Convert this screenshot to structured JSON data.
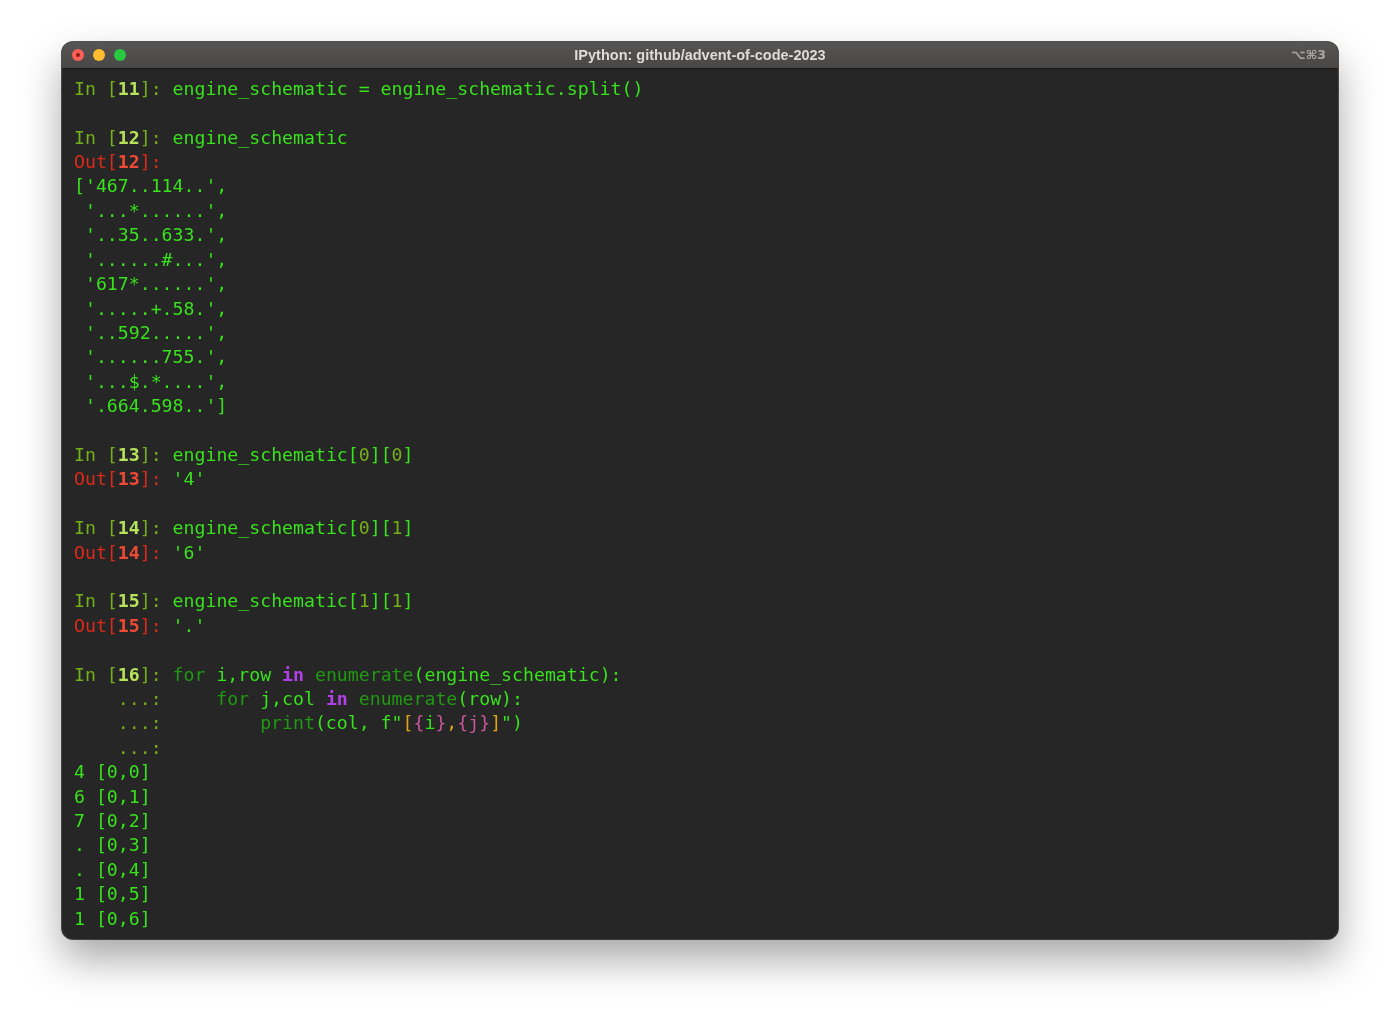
{
  "window": {
    "title": "IPython: github/advent-of-code-2023",
    "shortcut": "⌥⌘3"
  },
  "cells": [
    {
      "lines": [
        [
          {
            "kind": "p",
            "text": "In ["
          },
          {
            "kind": "pn",
            "text": "11"
          },
          {
            "kind": "p",
            "text": "]: "
          },
          {
            "kind": "c",
            "text": "engine_schematic = engine_schematic.split()"
          }
        ]
      ]
    },
    {
      "lines": [
        [
          {
            "kind": "p",
            "text": "In ["
          },
          {
            "kind": "pn",
            "text": "12"
          },
          {
            "kind": "p",
            "text": "]: "
          },
          {
            "kind": "c",
            "text": "engine_schematic"
          }
        ],
        [
          {
            "kind": "o",
            "text": "Out["
          },
          {
            "kind": "on",
            "text": "12"
          },
          {
            "kind": "o",
            "text": "]:"
          }
        ],
        [
          {
            "kind": "c",
            "text": "['467..114..',"
          }
        ],
        [
          {
            "kind": "c",
            "text": " '...*......',"
          }
        ],
        [
          {
            "kind": "c",
            "text": " '..35..633.',"
          }
        ],
        [
          {
            "kind": "c",
            "text": " '......#...',"
          }
        ],
        [
          {
            "kind": "c",
            "text": " '617*......',"
          }
        ],
        [
          {
            "kind": "c",
            "text": " '.....+.58.',"
          }
        ],
        [
          {
            "kind": "c",
            "text": " '..592.....',"
          }
        ],
        [
          {
            "kind": "c",
            "text": " '......755.',"
          }
        ],
        [
          {
            "kind": "c",
            "text": " '...$.*....',"
          }
        ],
        [
          {
            "kind": "c",
            "text": " '.664.598..']"
          }
        ]
      ]
    },
    {
      "lines": [
        [
          {
            "kind": "p",
            "text": "In ["
          },
          {
            "kind": "pn",
            "text": "13"
          },
          {
            "kind": "p",
            "text": "]: "
          },
          {
            "kind": "c",
            "text": "engine_schematic["
          },
          {
            "kind": "n",
            "text": "0"
          },
          {
            "kind": "c",
            "text": "]["
          },
          {
            "kind": "n",
            "text": "0"
          },
          {
            "kind": "c",
            "text": "]"
          }
        ],
        [
          {
            "kind": "o",
            "text": "Out["
          },
          {
            "kind": "on",
            "text": "13"
          },
          {
            "kind": "o",
            "text": "]: "
          },
          {
            "kind": "c",
            "text": "'4'"
          }
        ]
      ]
    },
    {
      "lines": [
        [
          {
            "kind": "p",
            "text": "In ["
          },
          {
            "kind": "pn",
            "text": "14"
          },
          {
            "kind": "p",
            "text": "]: "
          },
          {
            "kind": "c",
            "text": "engine_schematic["
          },
          {
            "kind": "n",
            "text": "0"
          },
          {
            "kind": "c",
            "text": "]["
          },
          {
            "kind": "n",
            "text": "1"
          },
          {
            "kind": "c",
            "text": "]"
          }
        ],
        [
          {
            "kind": "o",
            "text": "Out["
          },
          {
            "kind": "on",
            "text": "14"
          },
          {
            "kind": "o",
            "text": "]: "
          },
          {
            "kind": "c",
            "text": "'6'"
          }
        ]
      ]
    },
    {
      "lines": [
        [
          {
            "kind": "p",
            "text": "In ["
          },
          {
            "kind": "pn",
            "text": "15"
          },
          {
            "kind": "p",
            "text": "]: "
          },
          {
            "kind": "c",
            "text": "engine_schematic["
          },
          {
            "kind": "n",
            "text": "1"
          },
          {
            "kind": "c",
            "text": "]["
          },
          {
            "kind": "n",
            "text": "1"
          },
          {
            "kind": "c",
            "text": "]"
          }
        ],
        [
          {
            "kind": "o",
            "text": "Out["
          },
          {
            "kind": "on",
            "text": "15"
          },
          {
            "kind": "o",
            "text": "]: "
          },
          {
            "kind": "c",
            "text": "'.'"
          }
        ]
      ]
    },
    {
      "lines": [
        [
          {
            "kind": "p",
            "text": "In ["
          },
          {
            "kind": "pn",
            "text": "16"
          },
          {
            "kind": "p",
            "text": "]: "
          },
          {
            "kind": "k",
            "text": "for"
          },
          {
            "kind": "c",
            "text": " i,row "
          },
          {
            "kind": "w",
            "text": "in"
          },
          {
            "kind": "k",
            "text": " enumerate"
          },
          {
            "kind": "c",
            "text": "(engine_schematic):"
          }
        ],
        [
          {
            "kind": "p",
            "text": "    ...:     "
          },
          {
            "kind": "k",
            "text": "for"
          },
          {
            "kind": "c",
            "text": " j,col "
          },
          {
            "kind": "w",
            "text": "in"
          },
          {
            "kind": "k",
            "text": " enumerate"
          },
          {
            "kind": "c",
            "text": "(row):"
          }
        ],
        [
          {
            "kind": "p",
            "text": "    ...:         "
          },
          {
            "kind": "k",
            "text": "print"
          },
          {
            "kind": "c",
            "text": "(col, f\""
          },
          {
            "kind": "y",
            "text": "["
          },
          {
            "kind": "m",
            "text": "{"
          },
          {
            "kind": "c",
            "text": "i"
          },
          {
            "kind": "m",
            "text": "}"
          },
          {
            "kind": "y",
            "text": ","
          },
          {
            "kind": "m",
            "text": "{j}"
          },
          {
            "kind": "y",
            "text": "]"
          },
          {
            "kind": "c",
            "text": "\")"
          }
        ],
        [
          {
            "kind": "p",
            "text": "    ...:"
          }
        ],
        [
          {
            "kind": "c",
            "text": "4 [0,0]"
          }
        ],
        [
          {
            "kind": "c",
            "text": "6 [0,1]"
          }
        ],
        [
          {
            "kind": "c",
            "text": "7 [0,2]"
          }
        ],
        [
          {
            "kind": "c",
            "text": ". [0,3]"
          }
        ],
        [
          {
            "kind": "c",
            "text": ". [0,4]"
          }
        ],
        [
          {
            "kind": "c",
            "text": "1 [0,5]"
          }
        ],
        [
          {
            "kind": "c",
            "text": "1 [0,6]"
          }
        ]
      ]
    }
  ]
}
